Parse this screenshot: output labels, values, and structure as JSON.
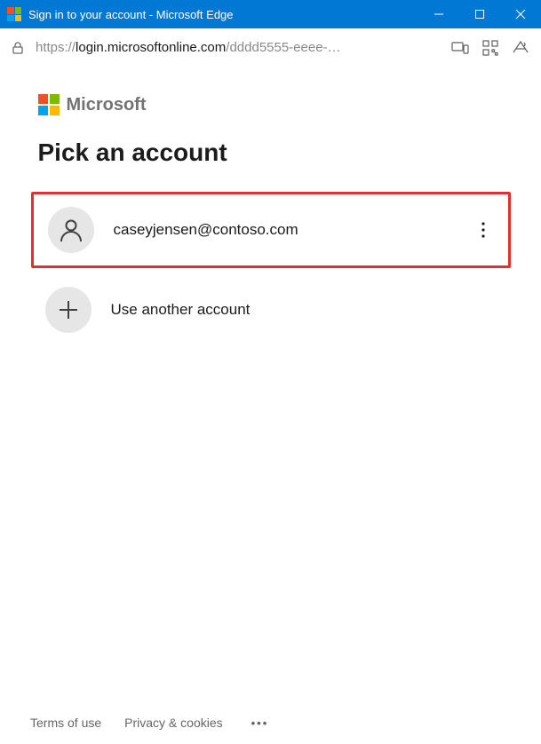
{
  "window": {
    "title": "Sign in to your account - Microsoft Edge"
  },
  "address": {
    "scheme": "https://",
    "host": "login.microsoftonline.com",
    "path_display": "/dddd5555-eeee-…"
  },
  "brand": {
    "name": "Microsoft"
  },
  "page": {
    "heading": "Pick an account"
  },
  "accounts": [
    {
      "email": "caseyjensen@contoso.com"
    }
  ],
  "use_another_label": "Use another account",
  "footer": {
    "terms": "Terms of use",
    "privacy": "Privacy & cookies"
  }
}
